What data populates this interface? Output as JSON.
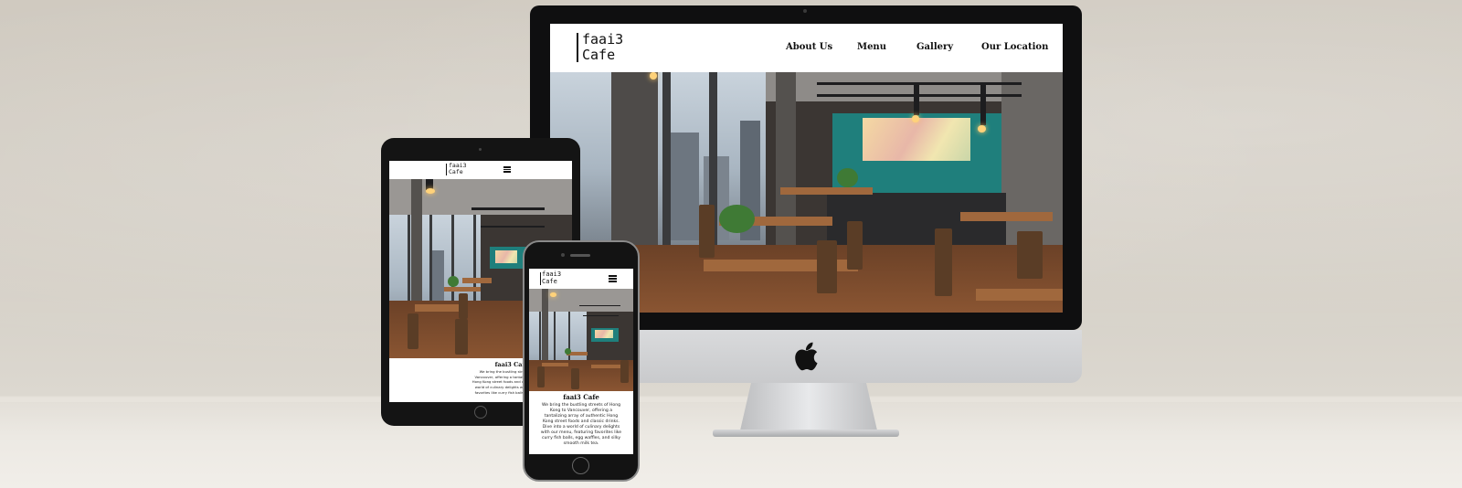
{
  "brand": {
    "logo_line1": "faai3",
    "logo_line2": "Cafe"
  },
  "desktop": {
    "nav": [
      "About Us",
      "Menu",
      "Gallery",
      "Our Location"
    ]
  },
  "mobile": {
    "title": "faai3 Cafe",
    "intro": "We bring the bustling streets of Hong Kong to Vancouver, offering a tantalizing array of authentic Hong Kong street foods and classic drinks. Dive into a world of culinary delights with our menu, featuring favorites like curry fish balls, egg waffles, and silky smooth milk tea."
  },
  "tablet": {
    "title": "faai3 Cafe",
    "intro": "We bring the bustling streets of Hong Kong to Vancouver, offering a tantalizing array of authentic Hong Kong street foods and classic drinks. Dive into a world of culinary delights with our menu, featuring favorites like curry fish balls, egg waffles, and silky"
  },
  "colors": {
    "accent_teal": "#1f7f7c",
    "wood": "#a0683d",
    "device_black": "#0f0f10"
  },
  "icons": [
    "apple-logo-icon",
    "hamburger-menu-icon"
  ]
}
